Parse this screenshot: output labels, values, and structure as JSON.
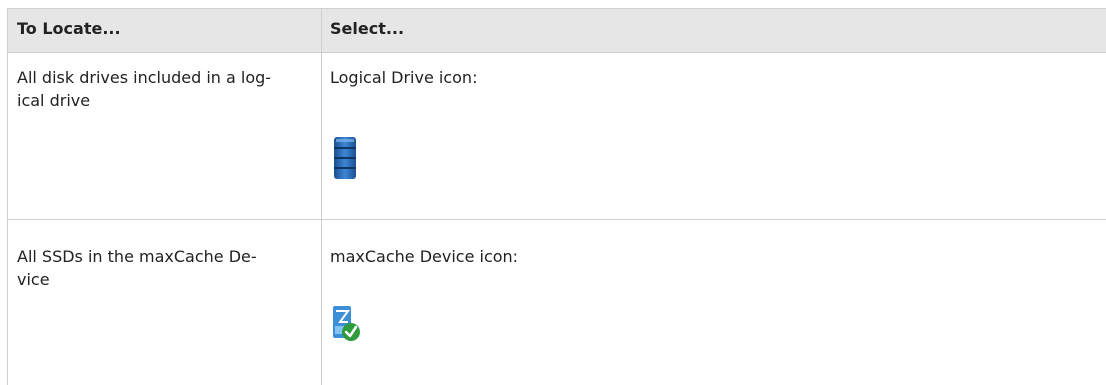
{
  "table": {
    "headers": [
      "To Locate...",
      "Select..."
    ],
    "rows": [
      {
        "locate_line1": "All disk drives included in a log-",
        "locate_line2": "ical drive",
        "select": "Logical Drive icon:",
        "icon": "logical-drive-icon"
      },
      {
        "locate_line1": "All SSDs in the maxCache De-",
        "locate_line2": "vice",
        "select": "maxCache Device icon:",
        "icon": "maxcache-device-icon"
      }
    ]
  },
  "colors": {
    "header_bg": "#e6e6e6",
    "grid": "#cfcfcf",
    "drive_blue": "#2f6fb8",
    "check_green": "#2e9b3c"
  }
}
